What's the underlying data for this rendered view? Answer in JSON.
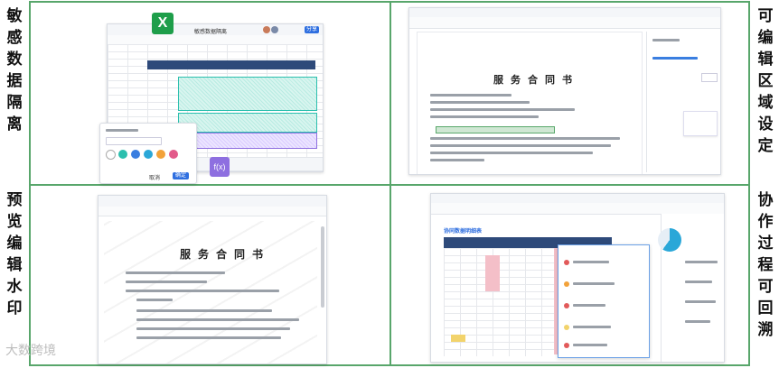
{
  "side_labels": {
    "left_top": "敏感数据隔离",
    "left_bottom": "预览编辑水印",
    "right_top": "可编辑区域设定",
    "right_bottom": "协作过程可回溯"
  },
  "brand_logo": "大数跨境",
  "panel_tl": {
    "excel_icon_letter": "X",
    "sheet_title": "敏感数据隔离",
    "formula_badge": "f(x)",
    "share_button": "分享",
    "dialog_cancel": "取消",
    "dialog_ok": "确定",
    "accent_teal": "#2cbfae",
    "accent_purple": "#8e6fe0"
  },
  "panel_tr": {
    "doc_title": "服务合同书"
  },
  "panel_bl": {
    "doc_title": "服务合同书"
  },
  "panel_br": {
    "table_header": "协同数据明细表"
  }
}
